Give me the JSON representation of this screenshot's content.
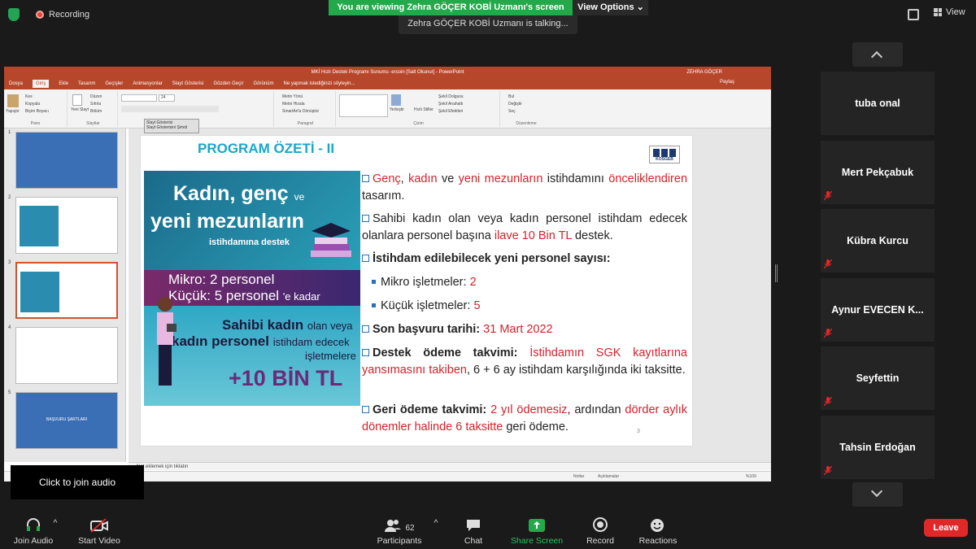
{
  "topbar": {
    "recording_label": "Recording",
    "banner": "You are viewing Zehra GÖÇER KOBİ Uzmanı's screen",
    "talking": "Zehra GÖÇER KOBİ Uzmanı is talking...",
    "view_options": "View Options",
    "view_label": "View"
  },
  "powerpoint": {
    "title": "MKİ Hızlı Destek Programı Sunumu -ersoin [Salt Okunur] - PowerPoint",
    "user": "ZEHRA GÖÇER",
    "share": "Paylaş",
    "menu": [
      "Dosya",
      "Giriş",
      "Ekle",
      "Tasarım",
      "Geçişler",
      "Animasyonlar",
      "Slayt Gösterisi",
      "Gözden Geçir",
      "Görünüm",
      "Ne yapmak istediğinizi söyleyin..."
    ],
    "active_menu": "Giriş",
    "ribbon": {
      "pano": "Pano",
      "slaytlar": "Slaytlar",
      "paragraf": "Paragraf",
      "cizim": "Çizim",
      "duzenleme": "Düzenleme",
      "yapistir": "Yapıştır",
      "kes": "Kes",
      "kopyala": "Kopyala",
      "bicim_boyaci": "Biçim Boyacı",
      "yeni_slayt": "Yeni Slayt",
      "duzen": "Düzen",
      "sifirla": "Sıfırla",
      "bolum": "Bölüm",
      "font_size": "24",
      "metin_yonu": "Metin Yönü",
      "metni_hizala": "Metni Hizala",
      "smartart": "SmartArt'a Dönüştür",
      "yerlestir": "Yerleştir",
      "hizli_stiller": "Hızlı Stiller",
      "sekil_dolgusu": "Şekil Dolgusu",
      "sekil_anahat": "Şekil Anahattı",
      "sekil_efekt": "Şekil Efektleri",
      "bul": "Bul",
      "degistir": "Değiştir",
      "sec": "Seç"
    },
    "tooltip": "Slayt Gösterisi",
    "tooltip_sub": "Slayt Gösterisini Şimdi",
    "slide_numbers": [
      "1",
      "2",
      "3",
      "4",
      "5"
    ],
    "thumb5_text": "BAŞVURU ŞARTLARI",
    "notes": "Not eklemek için tıklatın",
    "status": {
      "notlar": "Notlar",
      "aciklamalar": "Açıklamalar",
      "zoom": "%109"
    }
  },
  "slide": {
    "title": "PROGRAM ÖZETİ - II",
    "logo": "KOSGEB",
    "page": "3",
    "panel": {
      "line1": "Kadın, genç",
      "line1_ve": "ve",
      "line2": "yeni mezunların",
      "line3": "istihdamına destek",
      "mikro": "Mikro:   2 personel",
      "kucuk": "Küçük:  5 personel",
      "kucuk_suffix": "'e kadar",
      "sah1": "Sahibi kadın",
      "sah1_tail": "olan veya",
      "sah2": "kadın personel",
      "sah2_tail": "istihdam edecek",
      "sah3": "işletmelere",
      "big": "+10 BİN TL"
    },
    "bullets": {
      "b1_a": "Genç",
      "b1_b": ", ",
      "b1_c": "kadın",
      "b1_d": " ve ",
      "b1_e": "yeni mezunların",
      "b1_f": " istihdamını",
      "b1_g": "önceliklendiren",
      "b1_h": " tasarım.",
      "b2_a": "Sahibi kadın olan veya kadın personel istihdam edecek olanlara personel başına ",
      "b2_b": "ilave 10 Bin TL",
      "b2_c": " destek.",
      "b3": "İstihdam edilebilecek yeni personel sayısı:",
      "b4_a": "Mikro işletmeler: ",
      "b4_b": "2",
      "b5_a": "Küçük işletmeler: ",
      "b5_b": "5",
      "b6_a": "Son başvuru tarihi: ",
      "b6_b": "31 Mart 2022",
      "b7_a": "Destek ödeme takvimi: ",
      "b7_b": "İstihdamın SGK kayıtlarına yansımasını takiben",
      "b7_c": ", 6 + 6 ay istihdam karşılığında iki taksitte.",
      "b8_a": "Geri ödeme takvimi: ",
      "b8_b": "2 yıl ödemesiz",
      "b8_c": ", ardından ",
      "b8_d": "dörder aylık dönemler halinde 6 taksitte",
      "b8_e": " geri ödeme."
    }
  },
  "participants": [
    "tuba onal",
    "Mert Pekçabuk",
    "Kübra Kurcu",
    "Aynur EVECEN K...",
    "Seyfettin",
    "Tahsin Erdoğan"
  ],
  "toolbar": {
    "join_audio": "Join Audio",
    "start_video": "Start Video",
    "participants": "Participants",
    "participant_count": "62",
    "chat": "Chat",
    "share_screen": "Share Screen",
    "record": "Record",
    "reactions": "Reactions",
    "leave": "Leave",
    "audio_tooltip": "Click to join audio"
  },
  "colors": {
    "banner": "#23a94a",
    "powerpoint": "#b7472a",
    "leave": "#e02828",
    "accent_red": "#d3222a",
    "slide_title": "#19a7c9"
  }
}
